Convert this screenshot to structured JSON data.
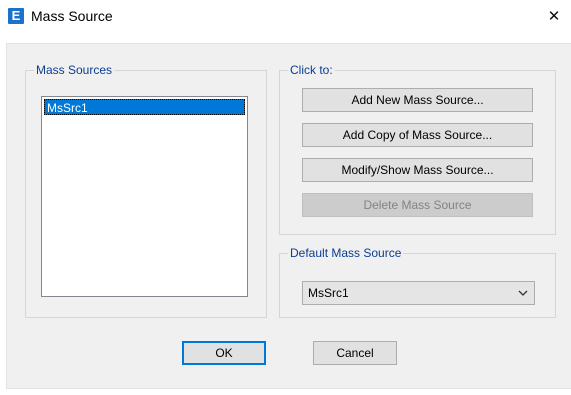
{
  "window": {
    "app_icon_letter": "E",
    "title": "Mass Source",
    "close_glyph": "✕"
  },
  "mass_sources": {
    "group_label": "Mass Sources",
    "items": [
      "MsSrc1"
    ],
    "selected": "MsSrc1"
  },
  "click_to": {
    "group_label": "Click to:",
    "buttons": [
      {
        "label": "Add New Mass Source...",
        "enabled": true
      },
      {
        "label": "Add Copy of Mass Source...",
        "enabled": true
      },
      {
        "label": "Modify/Show Mass Source...",
        "enabled": true
      },
      {
        "label": "Delete Mass Source",
        "enabled": false
      }
    ]
  },
  "default_mass_source": {
    "group_label": "Default Mass Source",
    "selected_value": "MsSrc1"
  },
  "footer": {
    "ok_label": "OK",
    "cancel_label": "Cancel"
  },
  "colors": {
    "accent": "#0078d7",
    "group_label": "#0b3d91",
    "app_icon": "#1a73c8"
  },
  "icons": {
    "app": "etabs-logo-icon",
    "close": "close-icon",
    "dropdown": "chevron-down-icon"
  }
}
